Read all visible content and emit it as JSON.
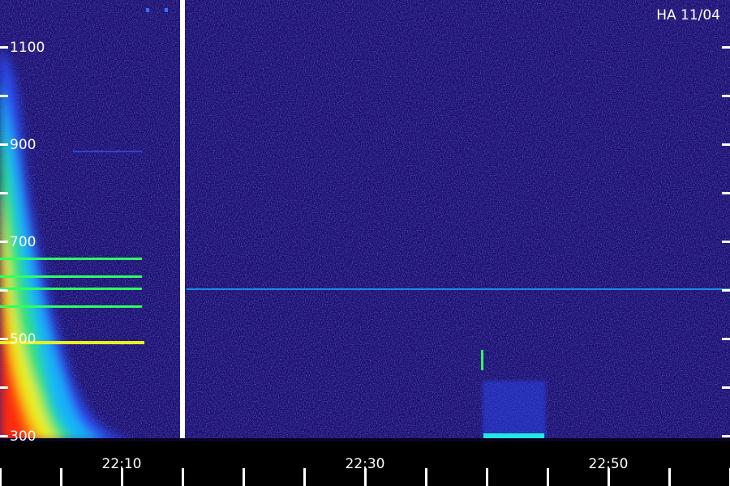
{
  "chart_data": {
    "type": "heatmap",
    "title": "",
    "xlabel": "",
    "ylabel": "",
    "stamp": "HA 11/04",
    "x_ticks": [
      "22:10",
      "22:30",
      "22:50"
    ],
    "y_ticks": [
      "300",
      "500",
      "700",
      "900",
      "1100"
    ],
    "ylim": [
      300,
      1100
    ],
    "grid": false,
    "colormap": [
      "#1a0a70",
      "#2233dd",
      "#10c8ff",
      "#30ff60",
      "#ffe000",
      "#ff3000"
    ]
  }
}
